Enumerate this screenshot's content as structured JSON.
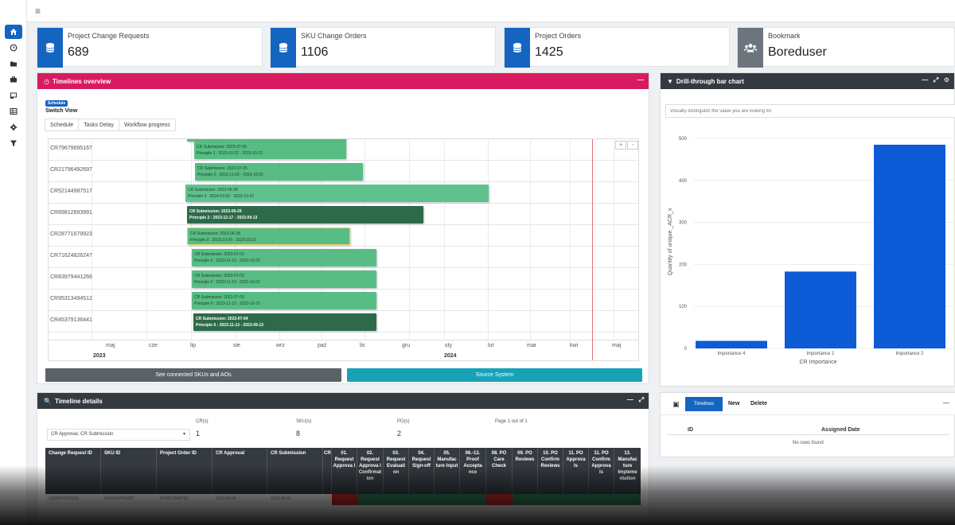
{
  "nav": {
    "items": [
      {
        "icon": "home-icon",
        "active": true
      },
      {
        "icon": "clock-icon"
      },
      {
        "icon": "folder-icon"
      },
      {
        "icon": "briefcase-icon"
      },
      {
        "icon": "inbox-icon"
      },
      {
        "icon": "table-icon"
      },
      {
        "icon": "gear-icon"
      },
      {
        "icon": "filter-icon"
      }
    ]
  },
  "infoboxes": [
    {
      "label": "Project Change Requests",
      "value": "689",
      "icon": "database-icon",
      "color": "#1565c0"
    },
    {
      "label": "SKU Change Orders",
      "value": "1106",
      "icon": "database-icon",
      "color": "#1565c0"
    },
    {
      "label": "Project Orders",
      "value": "1425",
      "icon": "database-icon",
      "color": "#1565c0"
    },
    {
      "label": "Bookmark",
      "value": "Boreduser",
      "icon": "users-icon",
      "color": "#6c757d"
    }
  ],
  "timeline": {
    "title": "Timelines overview",
    "badge": "Schedule",
    "switch_view": "Switch View",
    "tabs": [
      "Schedule",
      "Tasks Delay",
      "Workflow progress"
    ],
    "zoom_in": "+",
    "zoom_out": "-",
    "rows": [
      {
        "id": "CR79679695167",
        "line1": "CR Submission: 2023-07-05",
        "line2": "Principle 2 : 2023-10-22 - 2023-10-22",
        "dark": false
      },
      {
        "id": "CR21796492697",
        "line1": "CR Submission: 2023-07-05",
        "line2": "Principle 0 : 2023-11-03 - 2023-10-22",
        "dark": false
      },
      {
        "id": "CR52144987517",
        "line1": "CR Submission: 2023-06-28",
        "line2": "Principle 2 : 2024-03-02 - 2023-10-22",
        "dark": false
      },
      {
        "id": "CR69812893991",
        "line1": "CR Submission: 2023-06-29",
        "line2": "Principle 2 : 2023-12-17 - 2023-09-13",
        "dark": true
      },
      {
        "id": "CR28771679923",
        "line1": "CR Submission: 2023-06-28",
        "line2": "Principle 0 : 2023-10-25 - 2023-10-22",
        "dark": false
      },
      {
        "id": "CR71624826247",
        "line1": "CR Submission: 2023-07-03",
        "line2": "Principle 0 : 2023-11-13 - 2023-10-22",
        "dark": false
      },
      {
        "id": "CR83979441266",
        "line1": "CR Submission: 2023-07-03",
        "line2": "Principle 0 : 2023-11-13 - 2023-10-22",
        "dark": false
      },
      {
        "id": "CR95313494512",
        "line1": "CR Submission: 2023-07-03",
        "line2": "Principle 0 : 2023-11-13 - 2023-10-22",
        "dark": false
      },
      {
        "id": "CR45379136441",
        "line1": "CR Submission: 2023-07-04",
        "line2": "Principle 6 : 2023-11-13 - 2023-09-13",
        "dark": true
      }
    ],
    "months": [
      "maj",
      "cze",
      "lip",
      "sie",
      "wrz",
      "paź",
      "lis",
      "gru",
      "sty",
      "lut",
      "mar",
      "kwi",
      "maj"
    ],
    "years": [
      "2023",
      "2024"
    ],
    "btn_connected": "See connected SKUs and AOs",
    "btn_source": "Source System"
  },
  "drill": {
    "title": "Drill-through bar chart",
    "search_placeholder": "Visually distinguish the value you are looking for",
    "chart_data": {
      "type": "bar",
      "categories": [
        "Importance 4",
        "Importance 1",
        "Importance 2"
      ],
      "values": [
        18,
        183,
        485
      ],
      "xlabel": "CR Importance",
      "ylabel": "Quantity of unique _ACR_x",
      "ylim": [
        0,
        500
      ],
      "yticks": [
        0,
        100,
        200,
        300,
        400,
        500
      ],
      "color": "#0d5bd7"
    }
  },
  "details": {
    "title": "Timeline details",
    "select_value": "CR Approval, CR Submission",
    "cr_label": "CR(s)",
    "cr_value": "1",
    "sku_label": "SKU(s)",
    "sku_value": "8",
    "po_label": "PO(s)",
    "po_value": "2",
    "page_info": "Page 1 out of 1",
    "columns": [
      "Change Request ID",
      "SKU ID",
      "Project Order ID",
      "CR Approval",
      "CR Submission",
      "CR",
      "01. Request Approva l",
      "02. Request Approva l Confirmat ion",
      "03. Request Evaluati on",
      "04. Request Sign-off",
      "05. Manufac ture Input",
      "06.-12. Proof Accepta nce",
      "08. PO Care Check",
      "09. PO Reviews",
      "10. PO Confirm Reviews",
      "11. PO Approva ls",
      "11. PO Confirm Approva ls",
      "13. Manufac ture Impleme ntation"
    ],
    "row": [
      "CR20471870920",
      "SKU2547410387",
      "PO2527848752",
      "2023-06-04",
      "2023-06-26"
    ]
  },
  "bookmarks": {
    "tab_active": "Timelines",
    "new_label": "New",
    "delete_label": "Delete",
    "col_id": "ID",
    "col_date": "Assigned Date",
    "empty": "No rows found"
  }
}
